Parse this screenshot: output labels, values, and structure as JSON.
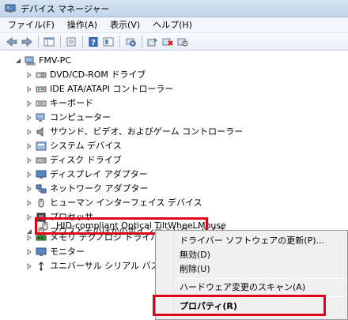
{
  "window": {
    "title": "デバイス マネージャー"
  },
  "menubar": {
    "file": "ファイル(F)",
    "action": "操作(A)",
    "view": "表示(V)",
    "help": "ヘルプ(H)"
  },
  "toolbar": {
    "icons": [
      "back-arrow-icon",
      "forward-arrow-icon",
      "console-tree-icon",
      "properties-icon",
      "help-icon",
      "show-hide-icon",
      "scan-hardware-icon",
      "update-driver-icon",
      "uninstall-icon",
      "disable-device-icon"
    ]
  },
  "tree": {
    "root": "FMV-PC",
    "items": [
      {
        "label": "DVD/CD-ROM ドライブ",
        "icon": "dvd-drive-icon"
      },
      {
        "label": "IDE ATA/ATAPI コントローラー",
        "icon": "ide-controller-icon"
      },
      {
        "label": "キーボード",
        "icon": "keyboard-icon"
      },
      {
        "label": "コンピューター",
        "icon": "computer-icon"
      },
      {
        "label": "サウンド、ビデオ、およびゲーム コントローラー",
        "icon": "speaker-icon"
      },
      {
        "label": "システム デバイス",
        "icon": "system-device-icon"
      },
      {
        "label": "ディスク ドライブ",
        "icon": "disk-drive-icon"
      },
      {
        "label": "ディスプレイ アダプター",
        "icon": "display-adapter-icon"
      },
      {
        "label": "ネットワーク アダプター",
        "icon": "network-adapter-icon"
      },
      {
        "label": "ヒューマン インターフェイス デバイス",
        "icon": "hid-icon"
      },
      {
        "label": "プロセッサ",
        "icon": "processor-icon"
      },
      {
        "label": "マウスとそのほかのポインティング デバイス",
        "icon": "mouse-icon"
      }
    ],
    "selected_child": "HID-compliant Optical TiltWheel Mouse",
    "after": [
      {
        "label": "メモリ テクノロジ ドライバー",
        "icon": "memory-icon"
      },
      {
        "label": "モニター",
        "icon": "monitor-icon"
      },
      {
        "label": "ユニバーサル シリアル バス コン",
        "icon": "usb-icon"
      }
    ]
  },
  "context_menu": {
    "update_driver": "ドライバー ソフトウェアの更新(P)...",
    "disable": "無効(D)",
    "uninstall": "削除(U)",
    "scan": "ハードウェア変更のスキャン(A)",
    "properties": "プロパティ(R)"
  },
  "colors": {
    "highlight_border": "#e0001a"
  }
}
